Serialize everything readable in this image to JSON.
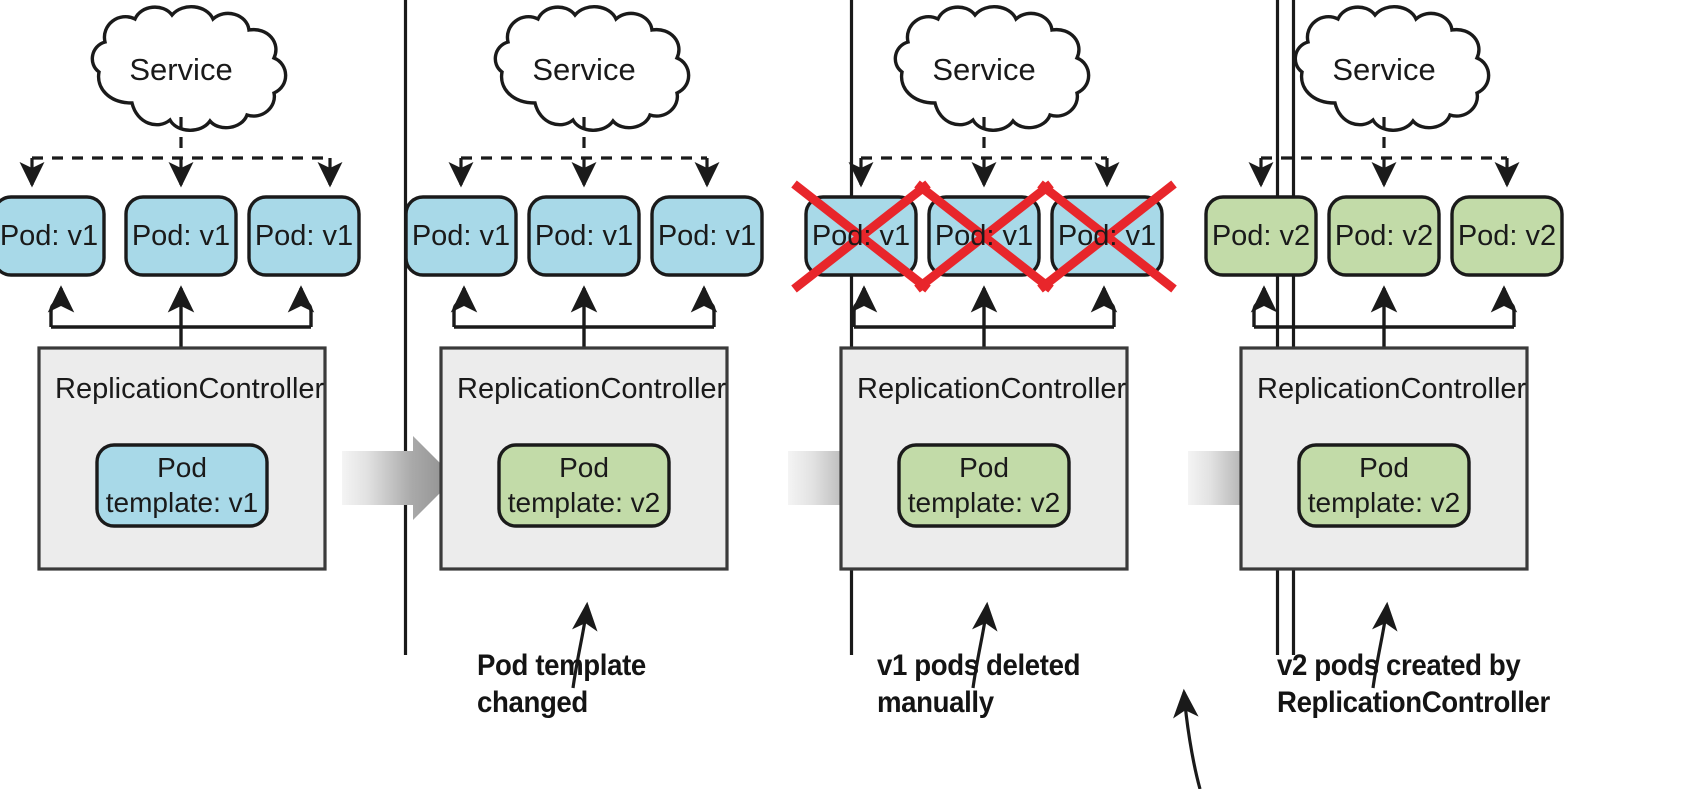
{
  "diagram": {
    "title": "ReplicationController rolling update with manual pod deletion",
    "type": "kubernetes-flow",
    "colors": {
      "pod_v1_fill": "#a8d9e8",
      "pod_v2_fill": "#c2dba8",
      "rc_fill": "#ececec",
      "stroke": "#1a1a1a",
      "delete_x": "#e8262b",
      "transition_arrow_light": "#f2f2f2",
      "transition_arrow_dark": "#8a8a8a"
    },
    "panels": [
      {
        "id": "panel-1",
        "service_label": "Service",
        "pods": [
          {
            "label": "Pod: v1",
            "version": "v1",
            "deleted": false
          },
          {
            "label": "Pod: v1",
            "version": "v1",
            "deleted": false
          },
          {
            "label": "Pod: v1",
            "version": "v1",
            "deleted": false
          }
        ],
        "controller_label": "ReplicationController",
        "template_label": "Pod\ntemplate: v1",
        "template_version": "v1",
        "caption": ""
      },
      {
        "id": "panel-2",
        "service_label": "Service",
        "pods": [
          {
            "label": "Pod: v1",
            "version": "v1",
            "deleted": false
          },
          {
            "label": "Pod: v1",
            "version": "v1",
            "deleted": false
          },
          {
            "label": "Pod: v1",
            "version": "v1",
            "deleted": false
          }
        ],
        "controller_label": "ReplicationController",
        "template_label": "Pod\ntemplate: v2",
        "template_version": "v2",
        "caption": "Pod template\nchanged"
      },
      {
        "id": "panel-3",
        "service_label": "Service",
        "pods": [
          {
            "label": "Pod: v1",
            "version": "v1",
            "deleted": true
          },
          {
            "label": "Pod: v1",
            "version": "v1",
            "deleted": true
          },
          {
            "label": "Pod: v1",
            "version": "v1",
            "deleted": true
          }
        ],
        "controller_label": "ReplicationController",
        "template_label": "Pod\ntemplate: v2",
        "template_version": "v2",
        "caption": "v1 pods deleted\nmanually"
      },
      {
        "id": "panel-4",
        "service_label": "Service",
        "pods": [
          {
            "label": "Pod: v2",
            "version": "v2",
            "deleted": false
          },
          {
            "label": "Pod: v2",
            "version": "v2",
            "deleted": false
          },
          {
            "label": "Pod: v2",
            "version": "v2",
            "deleted": false
          }
        ],
        "controller_label": "ReplicationController",
        "template_label": "Pod\ntemplate: v2",
        "template_version": "v2",
        "caption": "v2 pods created by\nReplicationController"
      }
    ]
  }
}
